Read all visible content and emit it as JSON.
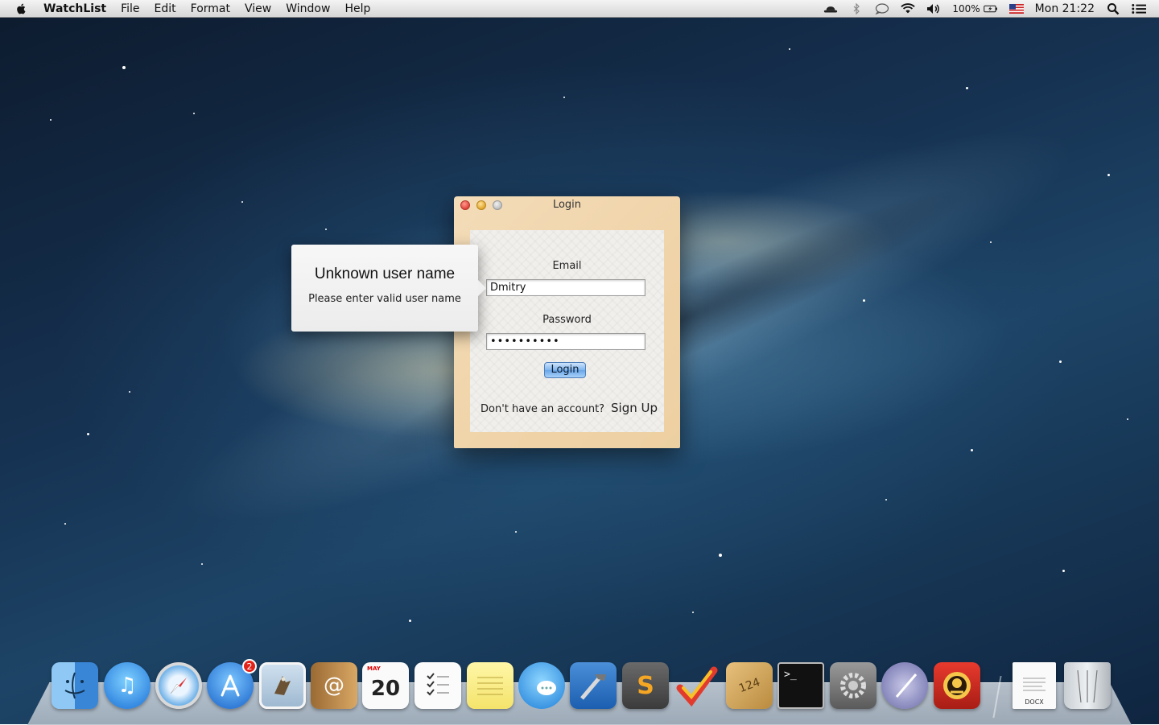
{
  "menubar": {
    "app_name": "WatchList",
    "items": [
      "File",
      "Edit",
      "Format",
      "View",
      "Window",
      "Help"
    ],
    "battery": "100%",
    "clock": "Mon 21:22"
  },
  "popover": {
    "title": "Unknown user name",
    "message": "Please enter valid user name"
  },
  "login_window": {
    "title": "Login",
    "email_label": "Email",
    "email_value": "Dmitry",
    "password_label": "Password",
    "password_value": "••••••••••",
    "login_button": "Login",
    "no_account_text": "Don't have an account?",
    "signup_link": "Sign Up"
  },
  "dock": {
    "app_store_badge": "2",
    "calendar_month": "MAY",
    "calendar_day": "20",
    "things_count": "124",
    "docx_label": "DOCX",
    "icons": [
      "finder-icon",
      "itunes-icon",
      "safari-icon",
      "app-store-icon",
      "mail-icon",
      "address-book-icon",
      "calendar-icon",
      "reminders-icon",
      "notes-icon",
      "messages-icon",
      "xcode-icon",
      "sublime-text-icon",
      "wunderlist-icon",
      "package-icon",
      "terminal-icon",
      "system-preferences-icon",
      "script-editor-icon",
      "screenflick-icon",
      "docx-file-icon",
      "trash-icon"
    ]
  }
}
